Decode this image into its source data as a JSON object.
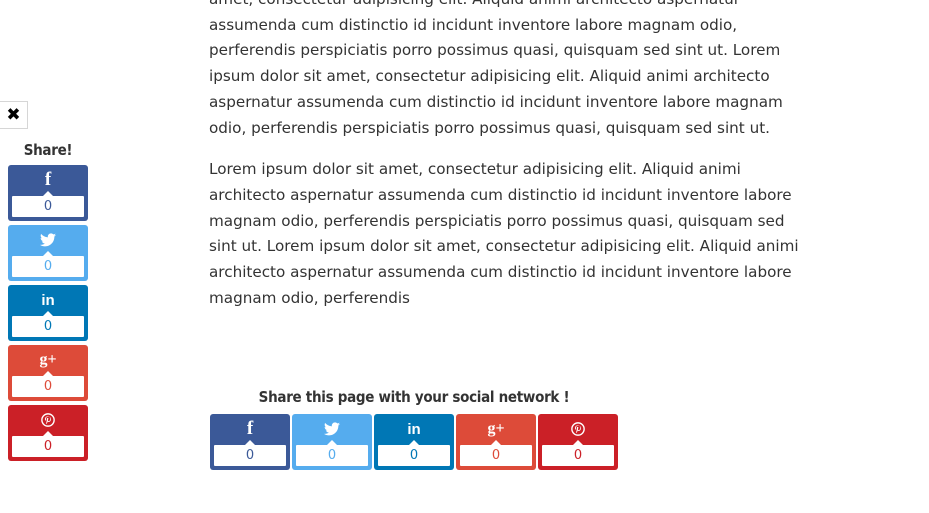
{
  "article": {
    "paragraphs": [
      "amet, consectetur adipisicing elit. Aliquid animi architecto aspernatur assumenda cum distinctio id incidunt inventore labore magnam odio, perferendis perspiciatis porro possimus quasi, quisquam sed sint ut. Lorem ipsum dolor sit amet, consectetur adipisicing elit. Aliquid animi architecto aspernatur assumenda cum distinctio id incidunt inventore labore magnam odio, perferendis perspiciatis porro possimus quasi, quisquam sed sint ut.",
      "Lorem ipsum dolor sit amet, consectetur adipisicing elit. Aliquid animi architecto aspernatur assumenda cum distinctio id incidunt inventore labore magnam odio, perferendis perspiciatis porro possimus quasi, quisquam sed sint ut. Lorem ipsum dolor sit amet, consectetur adipisicing elit. Aliquid animi architecto aspernatur assumenda cum distinctio id incidunt inventore labore magnam odio, perferendis"
    ]
  },
  "close_button": {
    "icon": "close-icon",
    "glyph": "✖"
  },
  "side_share": {
    "title": "Share!",
    "buttons": [
      {
        "network": "facebook",
        "icon": "facebook-icon",
        "glyph": "f",
        "count": "0",
        "color": "#3b5998"
      },
      {
        "network": "twitter",
        "icon": "twitter-icon",
        "glyph": "",
        "count": "0",
        "color": "#55acee"
      },
      {
        "network": "linkedin",
        "icon": "linkedin-icon",
        "glyph": "in",
        "count": "0",
        "color": "#0077b5"
      },
      {
        "network": "googleplus",
        "icon": "google-plus-icon",
        "glyph": "g+",
        "count": "0",
        "color": "#dd4b39"
      },
      {
        "network": "pinterest",
        "icon": "pinterest-icon",
        "glyph": "",
        "count": "0",
        "color": "#cb2027"
      }
    ]
  },
  "bottom_share": {
    "title": "Share this page with your social network !",
    "buttons": [
      {
        "network": "facebook",
        "icon": "facebook-icon",
        "glyph": "f",
        "count": "0",
        "color": "#3b5998"
      },
      {
        "network": "twitter",
        "icon": "twitter-icon",
        "glyph": "",
        "count": "0",
        "color": "#55acee"
      },
      {
        "network": "linkedin",
        "icon": "linkedin-icon",
        "glyph": "in",
        "count": "0",
        "color": "#0077b5"
      },
      {
        "network": "googleplus",
        "icon": "google-plus-icon",
        "glyph": "g+",
        "count": "0",
        "color": "#dd4b39"
      },
      {
        "network": "pinterest",
        "icon": "pinterest-icon",
        "glyph": "",
        "count": "0",
        "color": "#cb2027"
      }
    ]
  }
}
